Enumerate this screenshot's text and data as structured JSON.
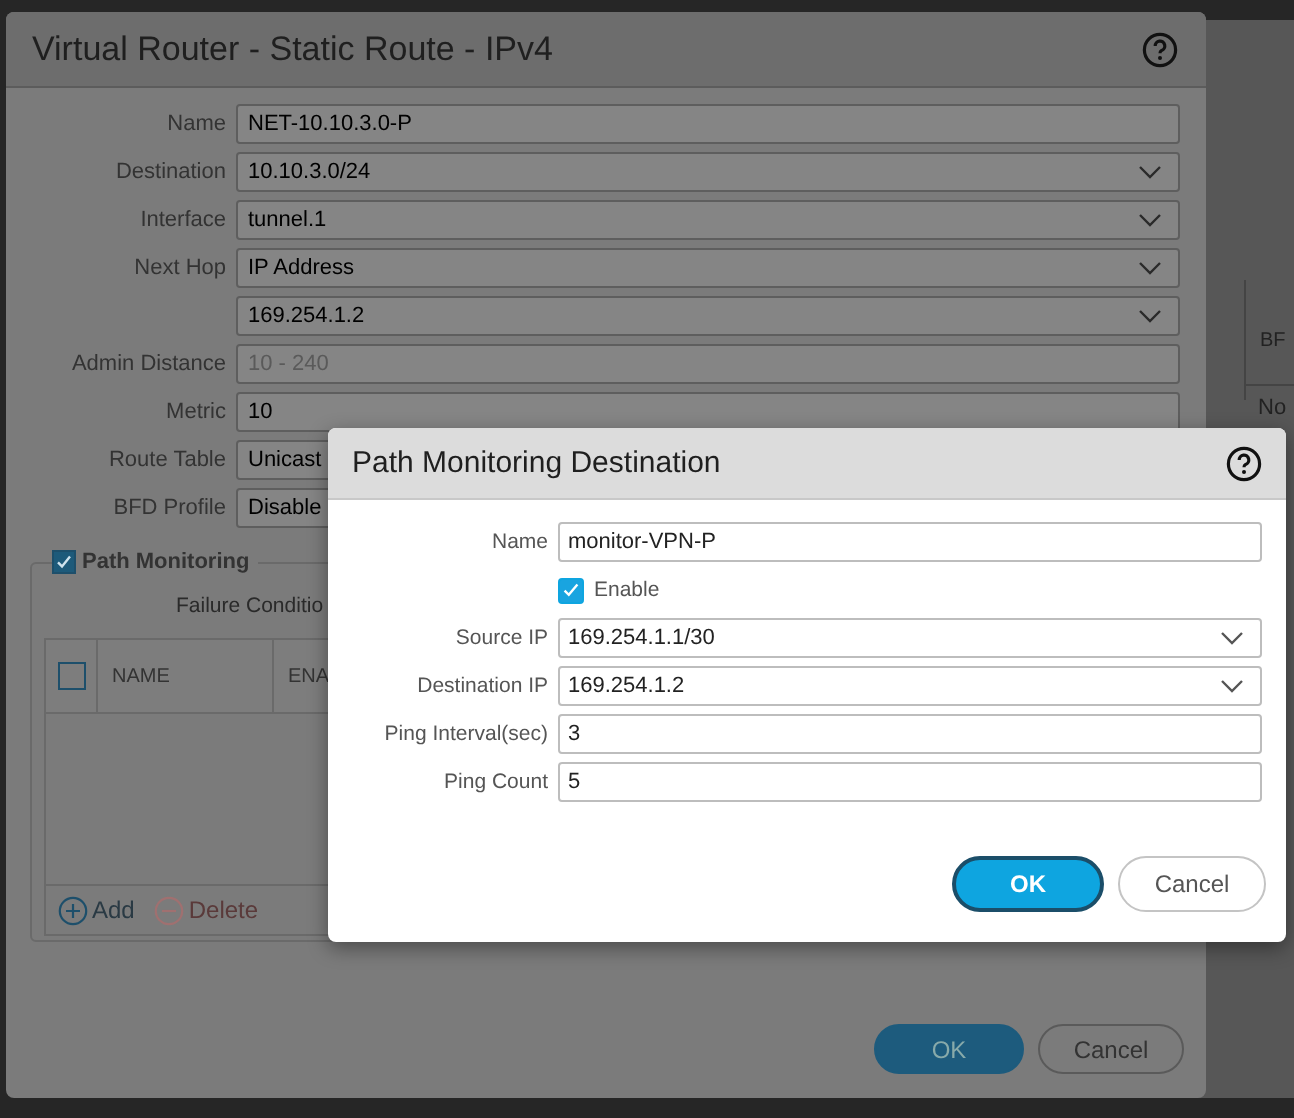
{
  "background_table": {
    "column_heading": "BF",
    "cell": "No"
  },
  "static_route_dialog": {
    "title": "Virtual Router - Static Route - IPv4",
    "fields": [
      {
        "label": "Name",
        "value": "NET-10.10.3.0-P",
        "kind": "text"
      },
      {
        "label": "Destination",
        "value": "10.10.3.0/24",
        "kind": "select"
      },
      {
        "label": "Interface",
        "value": "tunnel.1",
        "kind": "select"
      },
      {
        "label": "Next Hop",
        "value": "IP Address",
        "kind": "select"
      },
      {
        "value": "169.254.1.2",
        "kind": "select"
      },
      {
        "label": "Admin Distance",
        "placeholder": "10 - 240",
        "kind": "text"
      },
      {
        "label": "Metric",
        "value": "10",
        "kind": "text"
      },
      {
        "label": "Route Table",
        "value": "Unicast",
        "kind": "text"
      },
      {
        "label": "BFD Profile",
        "value": "Disable",
        "kind": "text"
      }
    ],
    "path_monitoring": {
      "label": "Path Monitoring",
      "checked": true,
      "failure_condition_label": "Failure Conditio",
      "table": {
        "select_all_checked": false,
        "columns": [
          "NAME",
          "ENA"
        ]
      },
      "actions": [
        {
          "label": "Add",
          "disabled": false
        },
        {
          "label": "Delete",
          "disabled": true
        }
      ]
    },
    "buttons": [
      {
        "label": "OK",
        "kind": "primary"
      },
      {
        "label": "Cancel",
        "kind": "secondary"
      }
    ]
  },
  "path_monitoring_dialog": {
    "title": "Path Monitoring Destination",
    "fields": [
      {
        "label": "Name",
        "value": "monitor-VPN-P",
        "kind": "text"
      },
      {
        "label": "Enable",
        "checked": true,
        "kind": "checkbox"
      },
      {
        "label": "Source IP",
        "value": "169.254.1.1/30",
        "kind": "select"
      },
      {
        "label": "Destination IP",
        "value": "169.254.1.2",
        "kind": "select"
      },
      {
        "label": "Ping Interval(sec)",
        "value": "3",
        "kind": "text"
      },
      {
        "label": "Ping Count",
        "value": "5",
        "kind": "text"
      }
    ],
    "buttons": [
      {
        "label": "OK",
        "kind": "primary"
      },
      {
        "label": "Cancel",
        "kind": "secondary"
      }
    ]
  }
}
